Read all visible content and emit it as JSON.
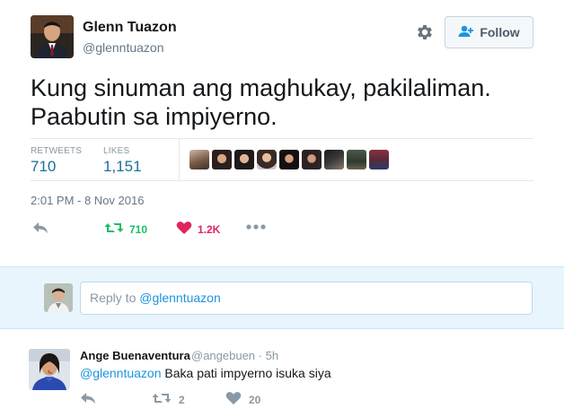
{
  "tweet": {
    "author_name": "Glenn Tuazon",
    "author_handle": "@glenntuazon",
    "follow_label": "Follow",
    "text_line1": "Kung sinuman ang maghukay, pakilaliman.",
    "text_line2": "Paabutin sa impiyerno.",
    "retweets_label": "RETWEETS",
    "retweets_value": "710",
    "likes_label": "LIKES",
    "likes_value": "1,151",
    "timestamp": "2:01 PM - 8 Nov 2016",
    "action_retweet_count": "710",
    "action_like_count": "1.2K"
  },
  "reply_box": {
    "prefix": "Reply to ",
    "mention": "@glenntuazon"
  },
  "reply": {
    "author_name": "Ange Buenaventura",
    "meta": "@angebuen · 5h",
    "mention": "@glenntuazon",
    "text": " Baka pati impyerno isuka siya",
    "retweet_count": "2",
    "like_count": "20"
  },
  "colors": {
    "retweet_green": "#17bf63",
    "like_red": "#e0245e",
    "link_blue": "#1b95e0",
    "icon_gray": "#8899a6"
  },
  "icons": [
    "gear-icon",
    "follow-user-icon",
    "reply-icon",
    "retweet-icon",
    "heart-icon",
    "more-icon"
  ]
}
